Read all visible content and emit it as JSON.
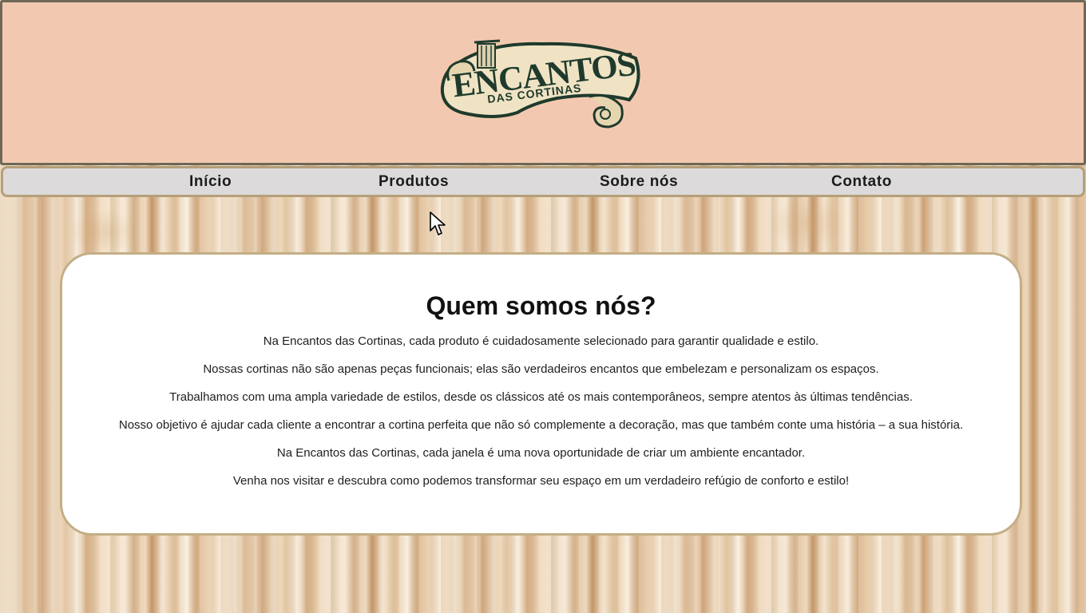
{
  "header": {
    "logo": {
      "text_main": "ENCANTOS",
      "text_sub": "DAS CORTINAS",
      "colors": {
        "scroll": "#efe3c4",
        "ink": "#1f3a2c"
      }
    },
    "background": "#f2c9b0"
  },
  "nav": {
    "items": [
      {
        "label": "Início"
      },
      {
        "label": "Produtos"
      },
      {
        "label": "Sobre nós"
      },
      {
        "label": "Contato"
      }
    ]
  },
  "about": {
    "title": "Quem somos nós?",
    "paragraphs": [
      "Na Encantos das Cortinas, cada produto é cuidadosamente selecionado para garantir qualidade e estilo.",
      "Nossas cortinas não são apenas peças funcionais; elas são verdadeiros encantos que embelezam e personalizam os espaços.",
      "Trabalhamos com uma ampla variedade de estilos, desde os clássicos até os mais contemporâneos, sempre atentos às últimas tendências.",
      "Nosso objetivo é ajudar cada cliente a encontrar a cortina perfeita que não só complemente a decoração, mas que também conte uma história – a sua história.",
      "Na Encantos das Cortinas, cada janela é uma nova oportunidade de criar um ambiente encantador.",
      "Venha nos visitar e descubra como podemos transformar seu espaço em um verdadeiro refúgio de conforto e estilo!"
    ]
  }
}
